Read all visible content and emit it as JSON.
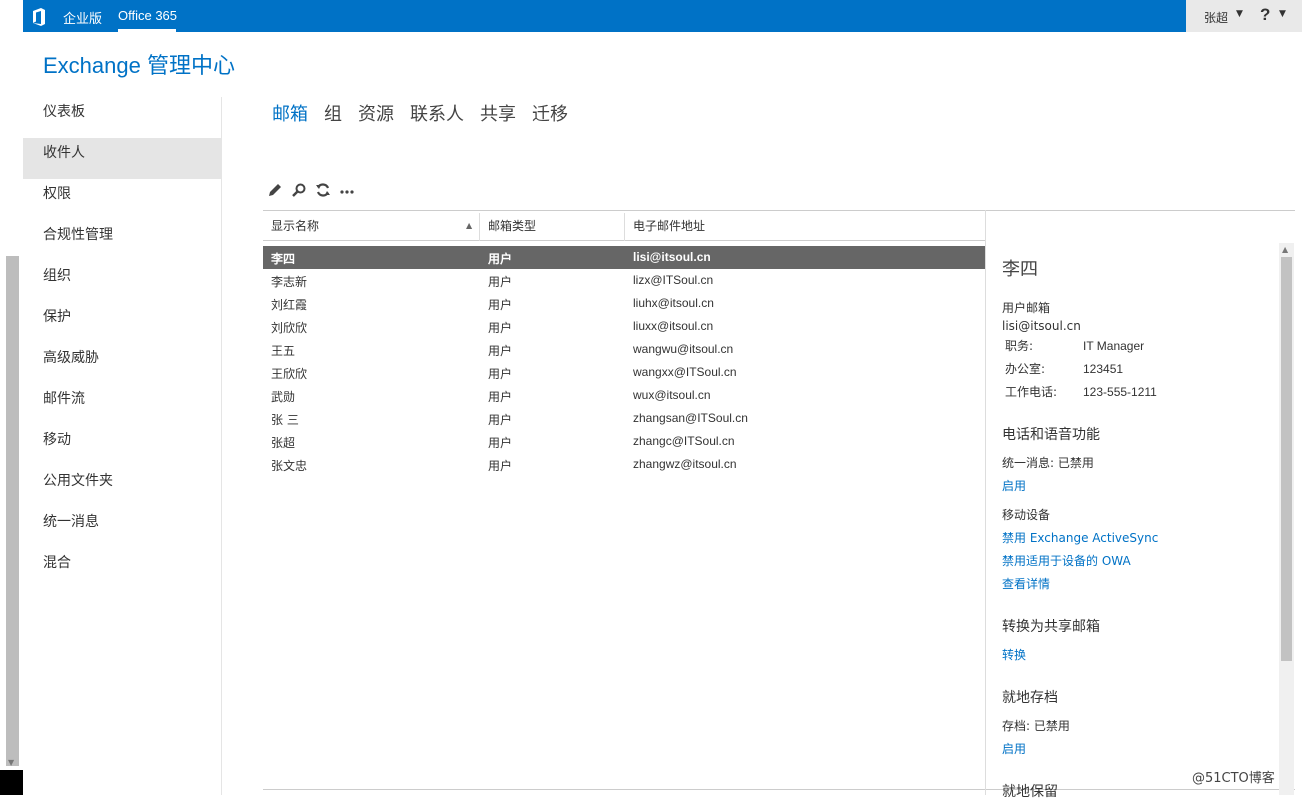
{
  "topbar": {
    "edition": "企业版",
    "product": "Office 365",
    "user": "张超",
    "help": "?"
  },
  "app_title": "Exchange 管理中心",
  "nav": [
    "仪表板",
    "收件人",
    "权限",
    "合规性管理",
    "组织",
    "保护",
    "高级威胁",
    "邮件流",
    "移动",
    "公用文件夹",
    "统一消息",
    "混合"
  ],
  "tabs": [
    "邮箱",
    "组",
    "资源",
    "联系人",
    "共享",
    "迁移"
  ],
  "columns": {
    "name": "显示名称",
    "type": "邮箱类型",
    "email": "电子邮件地址"
  },
  "rows": [
    {
      "name": "李四",
      "type": "用户",
      "email": "lisi@itsoul.cn"
    },
    {
      "name": "李志新",
      "type": "用户",
      "email": "lizx@ITSoul.cn"
    },
    {
      "name": "刘红霞",
      "type": "用户",
      "email": "liuhx@itsoul.cn"
    },
    {
      "name": "刘欣欣",
      "type": "用户",
      "email": "liuxx@itsoul.cn"
    },
    {
      "name": "王五",
      "type": "用户",
      "email": "wangwu@itsoul.cn"
    },
    {
      "name": "王欣欣",
      "type": "用户",
      "email": "wangxx@ITSoul.cn"
    },
    {
      "name": "武勋",
      "type": "用户",
      "email": "wux@itsoul.cn"
    },
    {
      "name": "张 三",
      "type": "用户",
      "email": "zhangsan@ITSoul.cn"
    },
    {
      "name": "张超",
      "type": "用户",
      "email": "zhangc@ITSoul.cn"
    },
    {
      "name": "张文忠",
      "type": "用户",
      "email": "zhangwz@itsoul.cn"
    }
  ],
  "details": {
    "name": "李四",
    "mailbox_type": "用户邮箱",
    "email": "lisi@itsoul.cn",
    "title_label": "职务:",
    "title_value": "IT Manager",
    "office_label": "办公室:",
    "office_value": "123451",
    "phone_label": "工作电话:",
    "phone_value": "123-555-1211",
    "phone_section": "电话和语音功能",
    "um_status": "统一消息:  已禁用",
    "um_enable": "启用",
    "mobile_label": "移动设备",
    "disable_eas": "禁用 Exchange ActiveSync",
    "disable_owa": "禁用适用于设备的 OWA",
    "view_details": "查看详情",
    "convert_section": "转换为共享邮箱",
    "convert": "转换",
    "archive_section": "就地存档",
    "archive_status": "存档:  已禁用",
    "archive_enable": "启用",
    "hold_section": "就地保留"
  },
  "watermark": "@51CTO博客",
  "colors": {
    "brand": "#0072c6",
    "selected_row": "#666666"
  }
}
